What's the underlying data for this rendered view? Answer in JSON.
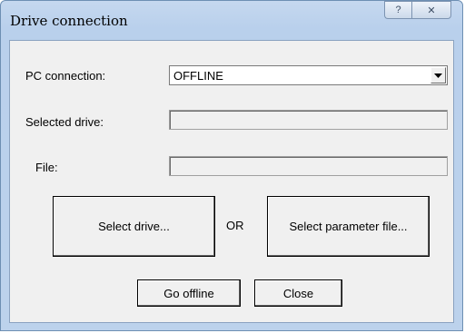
{
  "window": {
    "title": "Drive connection",
    "help_glyph": "?",
    "close_glyph": "✕"
  },
  "form": {
    "pc_connection_label": "PC connection:",
    "pc_connection_value": "OFFLINE",
    "selected_drive_label": "Selected drive:",
    "selected_drive_value": "",
    "file_label": "File:",
    "file_value": ""
  },
  "actions": {
    "select_drive_label": "Select drive...",
    "or_label": "OR",
    "select_parameter_file_label": "Select parameter file...",
    "go_offline_label": "Go offline",
    "close_label": "Close"
  },
  "icons": {
    "help": "question-mark-icon",
    "close": "close-icon",
    "dropdown": "chevron-down-icon"
  }
}
